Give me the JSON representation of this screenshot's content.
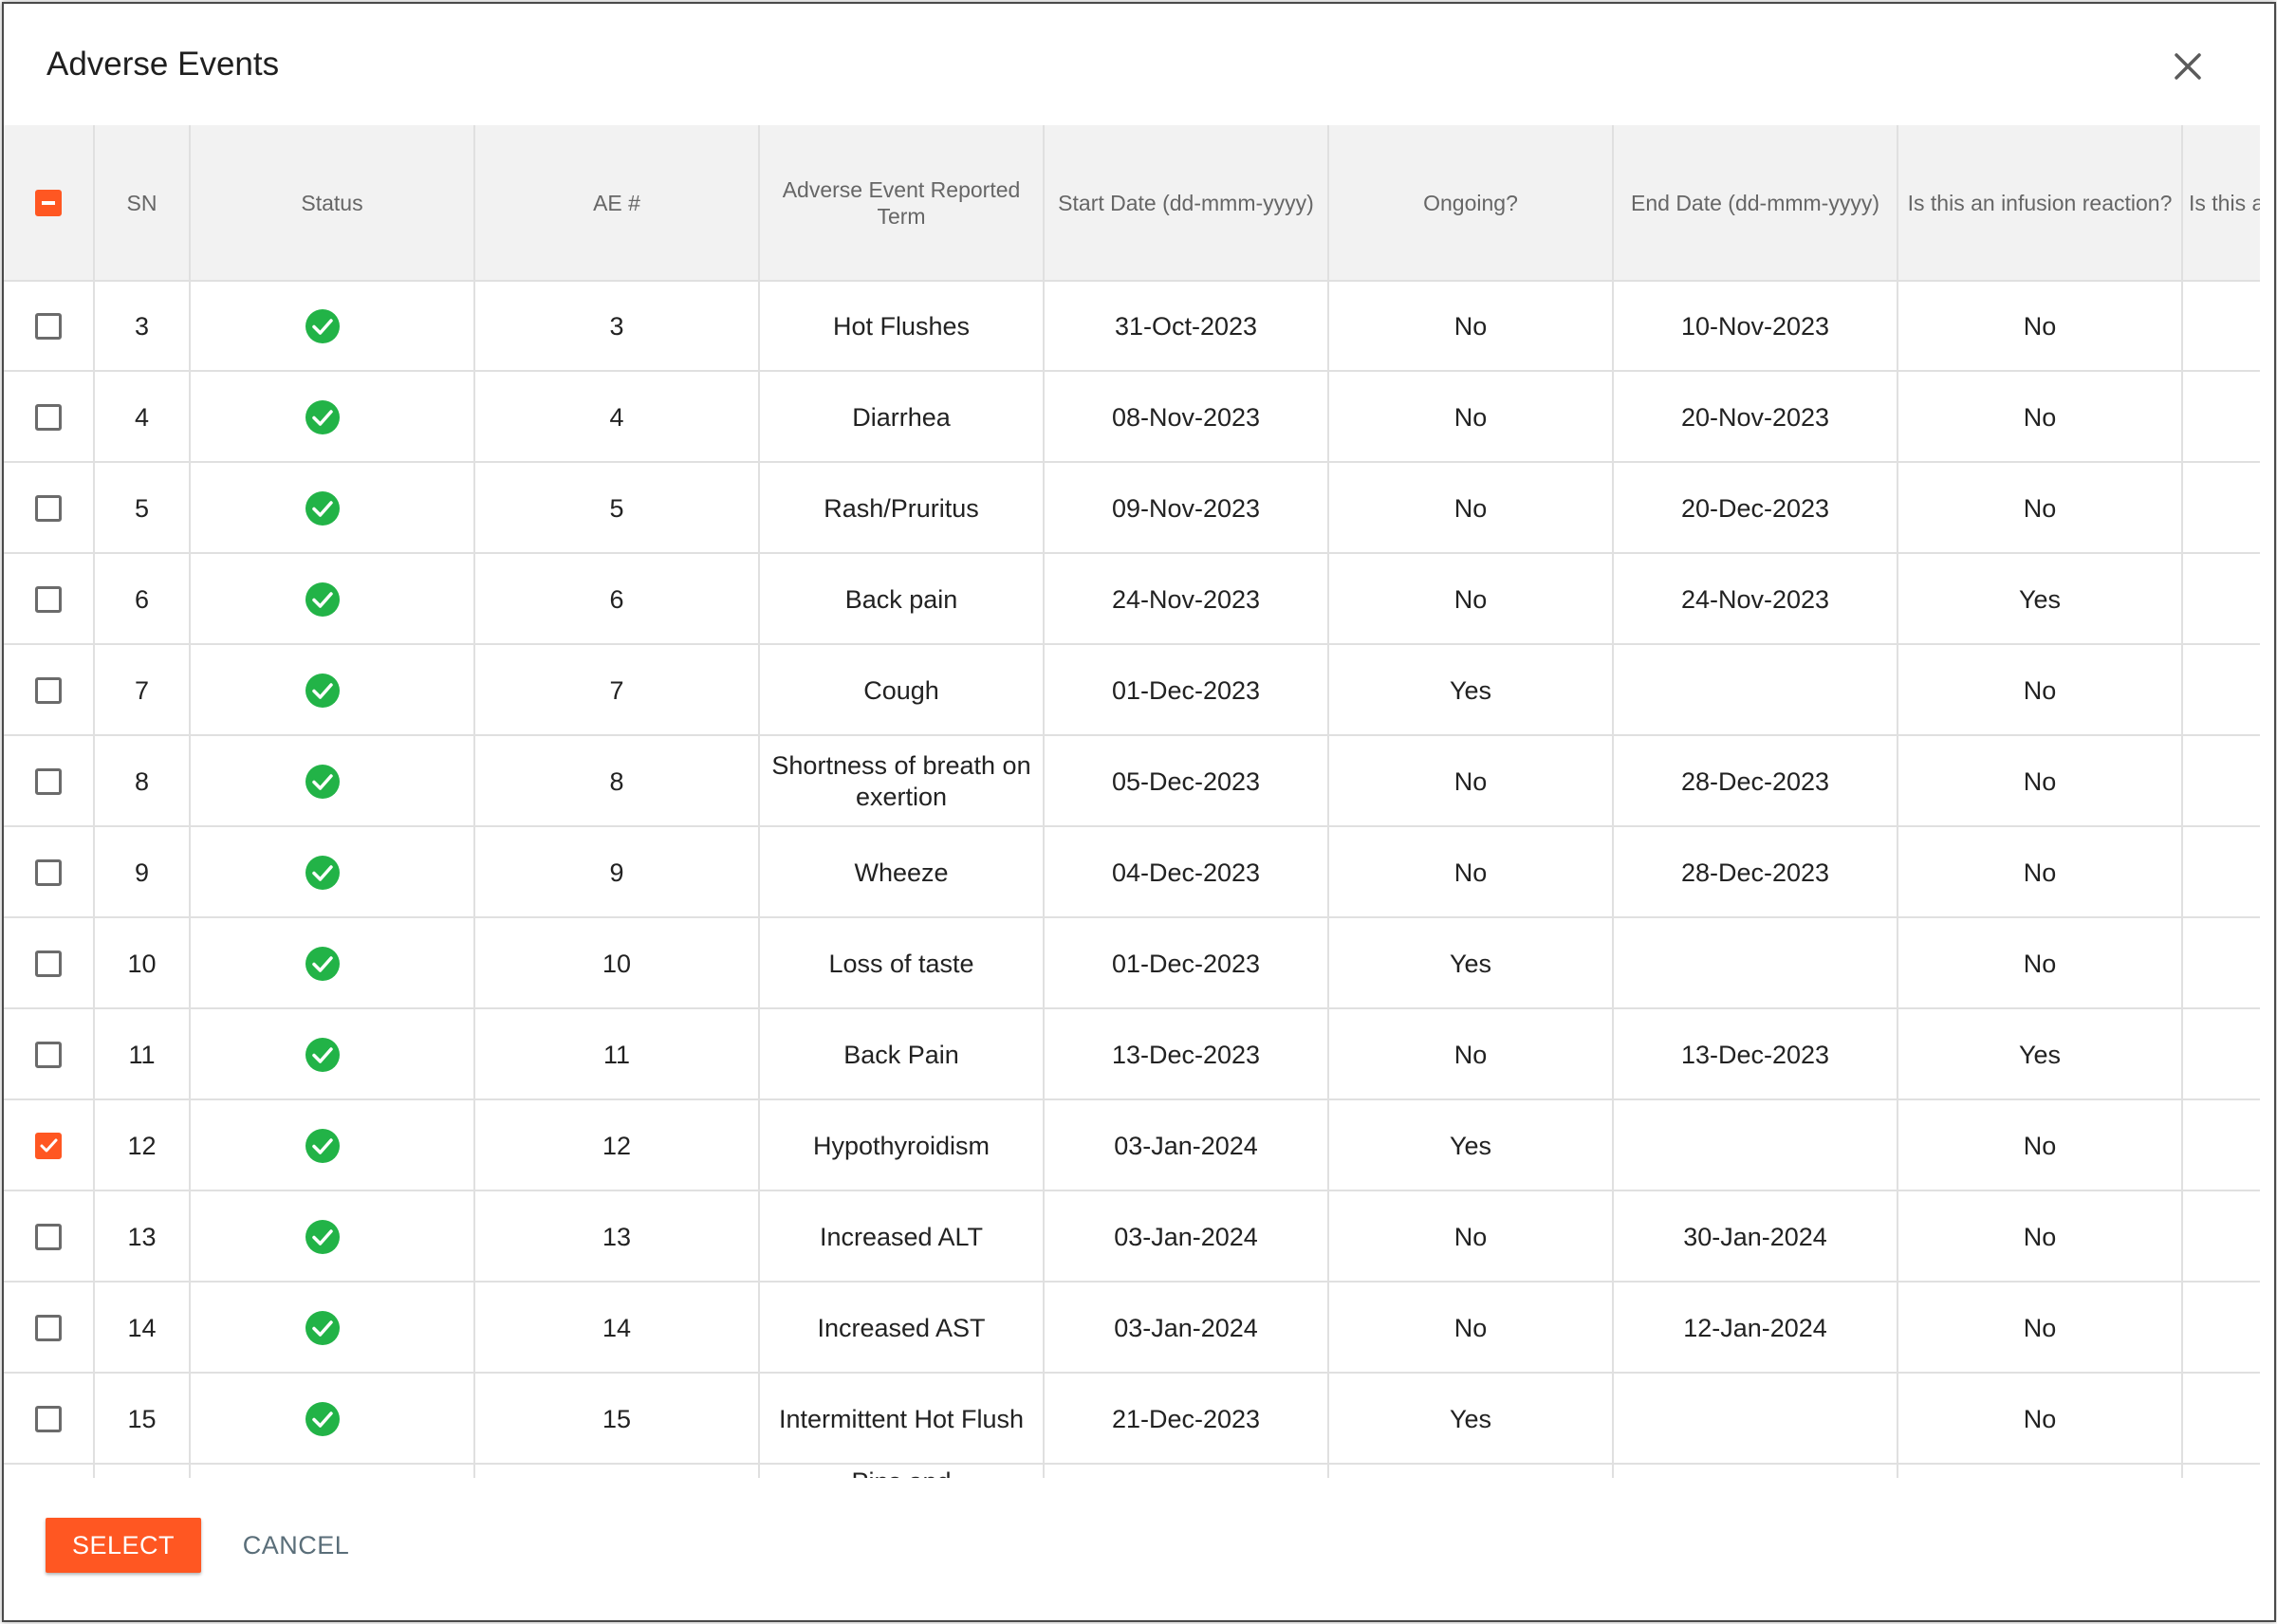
{
  "dialog": {
    "title": "Adverse Events",
    "close_icon": "close-icon"
  },
  "table": {
    "columns": [
      "",
      "SN",
      "Status",
      "AE #",
      "Adverse Event Reported Term",
      "Start Date (dd-mmm-yyyy)",
      "Ongoing?",
      "End Date (dd-mmm-yyyy)",
      "Is this an infusion reaction?",
      "Is this a"
    ],
    "select_all_state": "indeterminate",
    "rows": [
      {
        "checked": false,
        "sn": "3",
        "status": "complete",
        "ae": "3",
        "term": "Hot Flushes",
        "start": "31-Oct-2023",
        "ongoing": "No",
        "end": "10-Nov-2023",
        "infusion": "No"
      },
      {
        "checked": false,
        "sn": "4",
        "status": "complete",
        "ae": "4",
        "term": "Diarrhea",
        "start": "08-Nov-2023",
        "ongoing": "No",
        "end": "20-Nov-2023",
        "infusion": "No"
      },
      {
        "checked": false,
        "sn": "5",
        "status": "complete",
        "ae": "5",
        "term": "Rash/Pruritus",
        "start": "09-Nov-2023",
        "ongoing": "No",
        "end": "20-Dec-2023",
        "infusion": "No"
      },
      {
        "checked": false,
        "sn": "6",
        "status": "complete",
        "ae": "6",
        "term": "Back pain",
        "start": "24-Nov-2023",
        "ongoing": "No",
        "end": "24-Nov-2023",
        "infusion": "Yes"
      },
      {
        "checked": false,
        "sn": "7",
        "status": "complete",
        "ae": "7",
        "term": "Cough",
        "start": "01-Dec-2023",
        "ongoing": "Yes",
        "end": "",
        "infusion": "No"
      },
      {
        "checked": false,
        "sn": "8",
        "status": "complete",
        "ae": "8",
        "term": "Shortness of breath on exertion",
        "start": "05-Dec-2023",
        "ongoing": "No",
        "end": "28-Dec-2023",
        "infusion": "No"
      },
      {
        "checked": false,
        "sn": "9",
        "status": "complete",
        "ae": "9",
        "term": "Wheeze",
        "start": "04-Dec-2023",
        "ongoing": "No",
        "end": "28-Dec-2023",
        "infusion": "No"
      },
      {
        "checked": false,
        "sn": "10",
        "status": "complete",
        "ae": "10",
        "term": "Loss of taste",
        "start": "01-Dec-2023",
        "ongoing": "Yes",
        "end": "",
        "infusion": "No"
      },
      {
        "checked": false,
        "sn": "11",
        "status": "complete",
        "ae": "11",
        "term": "Back Pain",
        "start": "13-Dec-2023",
        "ongoing": "No",
        "end": "13-Dec-2023",
        "infusion": "Yes"
      },
      {
        "checked": true,
        "sn": "12",
        "status": "complete",
        "ae": "12",
        "term": "Hypothyroidism",
        "start": "03-Jan-2024",
        "ongoing": "Yes",
        "end": "",
        "infusion": "No"
      },
      {
        "checked": false,
        "sn": "13",
        "status": "complete",
        "ae": "13",
        "term": "Increased ALT",
        "start": "03-Jan-2024",
        "ongoing": "No",
        "end": "30-Jan-2024",
        "infusion": "No"
      },
      {
        "checked": false,
        "sn": "14",
        "status": "complete",
        "ae": "14",
        "term": "Increased AST",
        "start": "03-Jan-2024",
        "ongoing": "No",
        "end": "12-Jan-2024",
        "infusion": "No"
      },
      {
        "checked": false,
        "sn": "15",
        "status": "complete",
        "ae": "15",
        "term": "Intermittent Hot Flush",
        "start": "21-Dec-2023",
        "ongoing": "Yes",
        "end": "",
        "infusion": "No"
      },
      {
        "checked": false,
        "sn": "",
        "status": "",
        "ae": "",
        "term": "Pins and",
        "start": "",
        "ongoing": "",
        "end": "",
        "infusion": ""
      }
    ]
  },
  "footer": {
    "select_label": "SELECT",
    "cancel_label": "CANCEL"
  },
  "colors": {
    "accent": "#ff5722",
    "status_ok": "#22b347"
  }
}
